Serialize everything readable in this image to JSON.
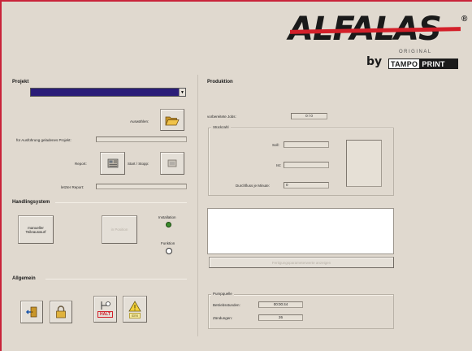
{
  "logo": {
    "brand": "ALFALAS",
    "registered": "®",
    "original": "ORIGINAL",
    "by": "by",
    "tampo_part1": "TAMPO",
    "tampo_part2": "PRINT"
  },
  "projekt": {
    "title": "Projekt",
    "select_label": "Auswählen:",
    "loaded_label": "für Ausführung geladenes Projekt:",
    "loaded_value": "",
    "report_label": "Report:",
    "start_stop_label": "Start / Stopp:",
    "last_report_label": "letzter Report:",
    "last_report_value": ""
  },
  "handling": {
    "title": "Handlingsystem",
    "manual_button": "manueller Teileauswurf",
    "disabled_button": "in Position",
    "installation_label": "Installation",
    "funktion_label": "Funktion"
  },
  "allgemein": {
    "title": "Allgemein",
    "halt_label": "HALT",
    "ein_label": "EIN"
  },
  "produktion": {
    "title": "Produktion",
    "jobs_label": "vorbereitete Jobs:",
    "jobs_value": "0 / 0",
    "stueckzahl": {
      "legend": "Stückzahl",
      "soll_label": "Soll:",
      "soll_value": "",
      "ist_label": "Ist:",
      "ist_value": "",
      "durchfluss_label": "Durchfluss je Minute:",
      "durchfluss_value": "0"
    },
    "parameter_button": "Fertigungsparameterwerte anzeigen"
  },
  "pumpquelle": {
    "legend": "Pumpquelle",
    "betriebsstunden_label": "Betriebsstunden:",
    "betriebsstunden_value": "00:00:44",
    "zuendungen_label": "Zündungen:",
    "zuendungen_value": "26"
  },
  "colors": {
    "background": "#e0d9cf",
    "combo_fill": "#2a1d78",
    "accent_red": "#d3202a",
    "led_green": "#3a8a2a"
  },
  "icons": [
    "open-folder-icon",
    "report-icon",
    "start-stop-icon",
    "exit-door-icon",
    "lock-icon",
    "halt-icon",
    "warning-ein-icon"
  ]
}
